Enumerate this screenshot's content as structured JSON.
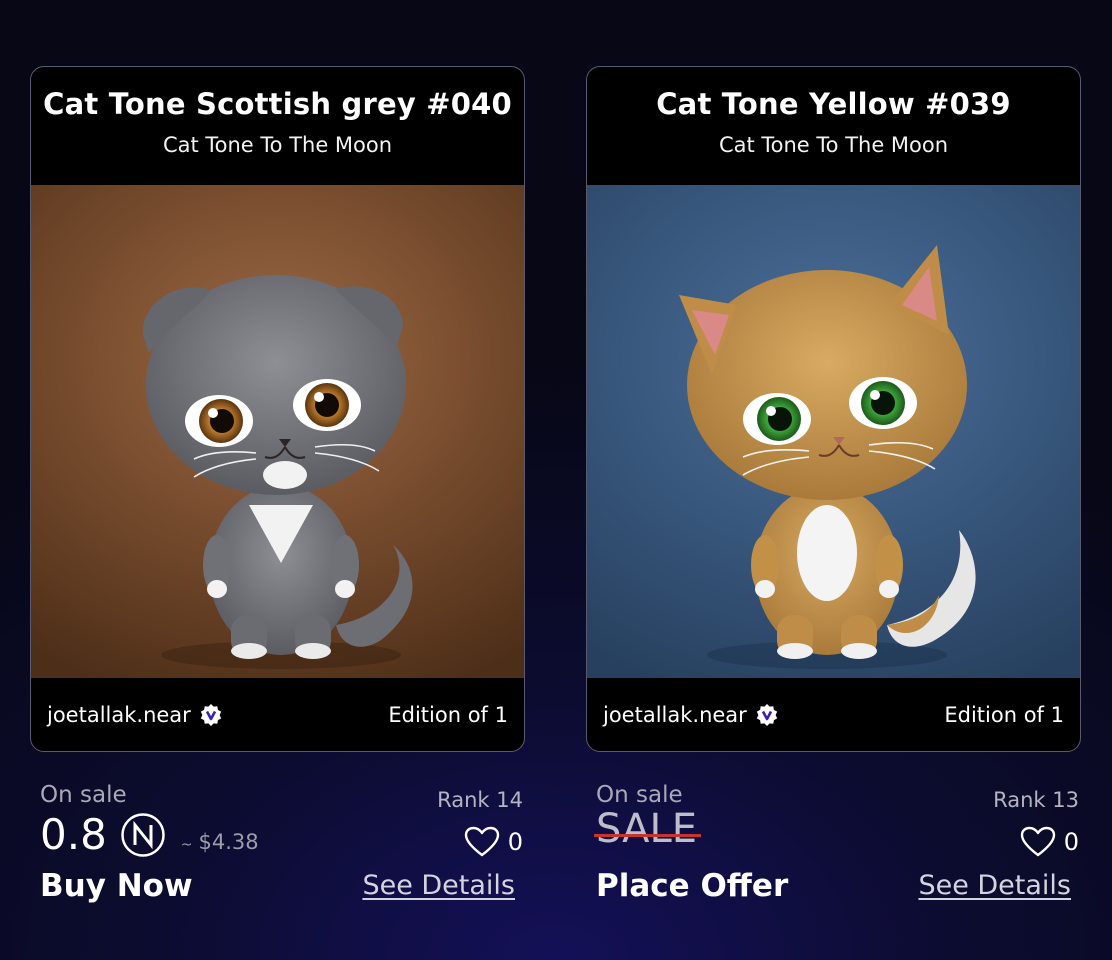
{
  "cards": [
    {
      "title": "Cat Tone Scottish grey #040",
      "collection": "Cat Tone To The Moon",
      "owner": "joetallak.near",
      "edition": "Edition of 1",
      "status": "On sale",
      "rank": "Rank 14",
      "price": "0.8",
      "price_usd": "$4.38",
      "likes": "0",
      "cta": "Buy Now",
      "details": "See Details",
      "background": "#7a4e2f",
      "fur_color": "#7b7c82"
    },
    {
      "title": "Cat Tone Yellow #039",
      "collection": "Cat Tone To The Moon",
      "owner": "joetallak.near",
      "edition": "Edition of 1",
      "status": "On sale",
      "rank": "Rank 13",
      "sale_label": "SALE",
      "likes": "0",
      "cta": "Place Offer",
      "details": "See Details",
      "background": "#3a5a80",
      "fur_color": "#c89a52"
    }
  ],
  "usd_prefix": "~",
  "icons": {
    "verified": "verified-badge-icon",
    "currency": "near-currency-icon",
    "like": "heart-icon"
  }
}
